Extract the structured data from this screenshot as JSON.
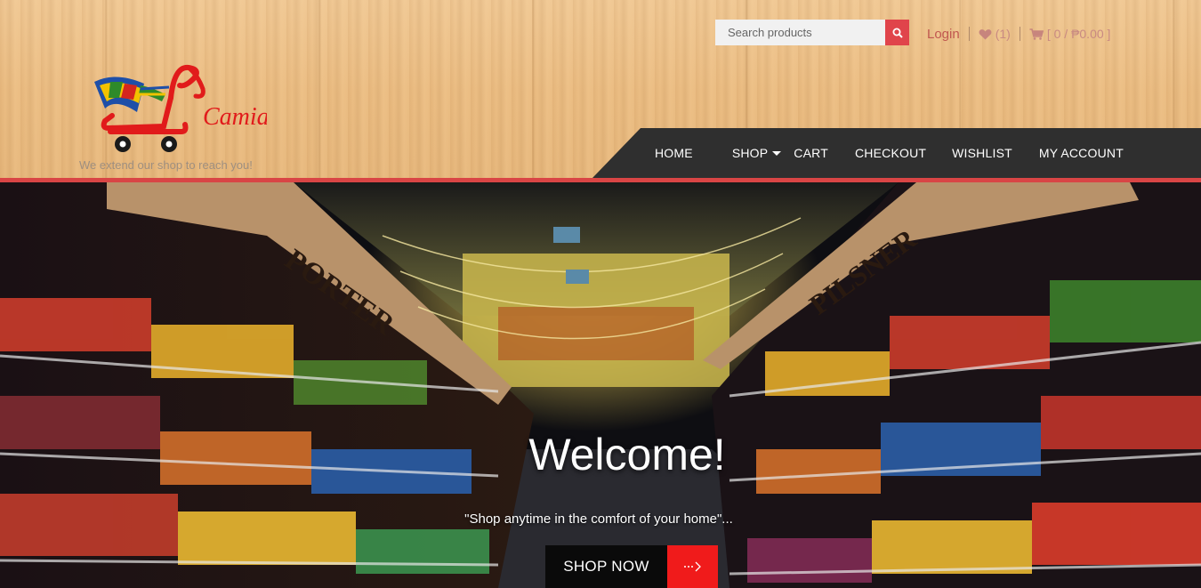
{
  "header": {
    "search": {
      "placeholder": "Search products",
      "value": ""
    },
    "login_label": "Login",
    "wishlist_count": "(1)",
    "cart_summary": "[ 0 / ₱0.00 ]",
    "tagline": "We extend our shop to reach you!",
    "logo_text": "Camia",
    "icons": {
      "search": "search-icon",
      "wishlist": "heart-icon",
      "cart": "cart-icon"
    },
    "colors": {
      "accent": "#e0444b",
      "nav_bg": "#2f2f2f",
      "link": "#c0574f"
    }
  },
  "nav": {
    "items": [
      {
        "label": "HOME"
      },
      {
        "label": "SHOP"
      },
      {
        "label": "CART"
      },
      {
        "label": "CHECKOUT"
      },
      {
        "label": "WISHLIST"
      },
      {
        "label": "MY ACCOUNT"
      }
    ]
  },
  "hero": {
    "title": "Welcome!",
    "subtitle": "\"Shop anytime in the comfort of your home\"...",
    "cta_label": "SHOP NOW",
    "sign_left": "PORTER",
    "sign_right": "PILSNER"
  }
}
